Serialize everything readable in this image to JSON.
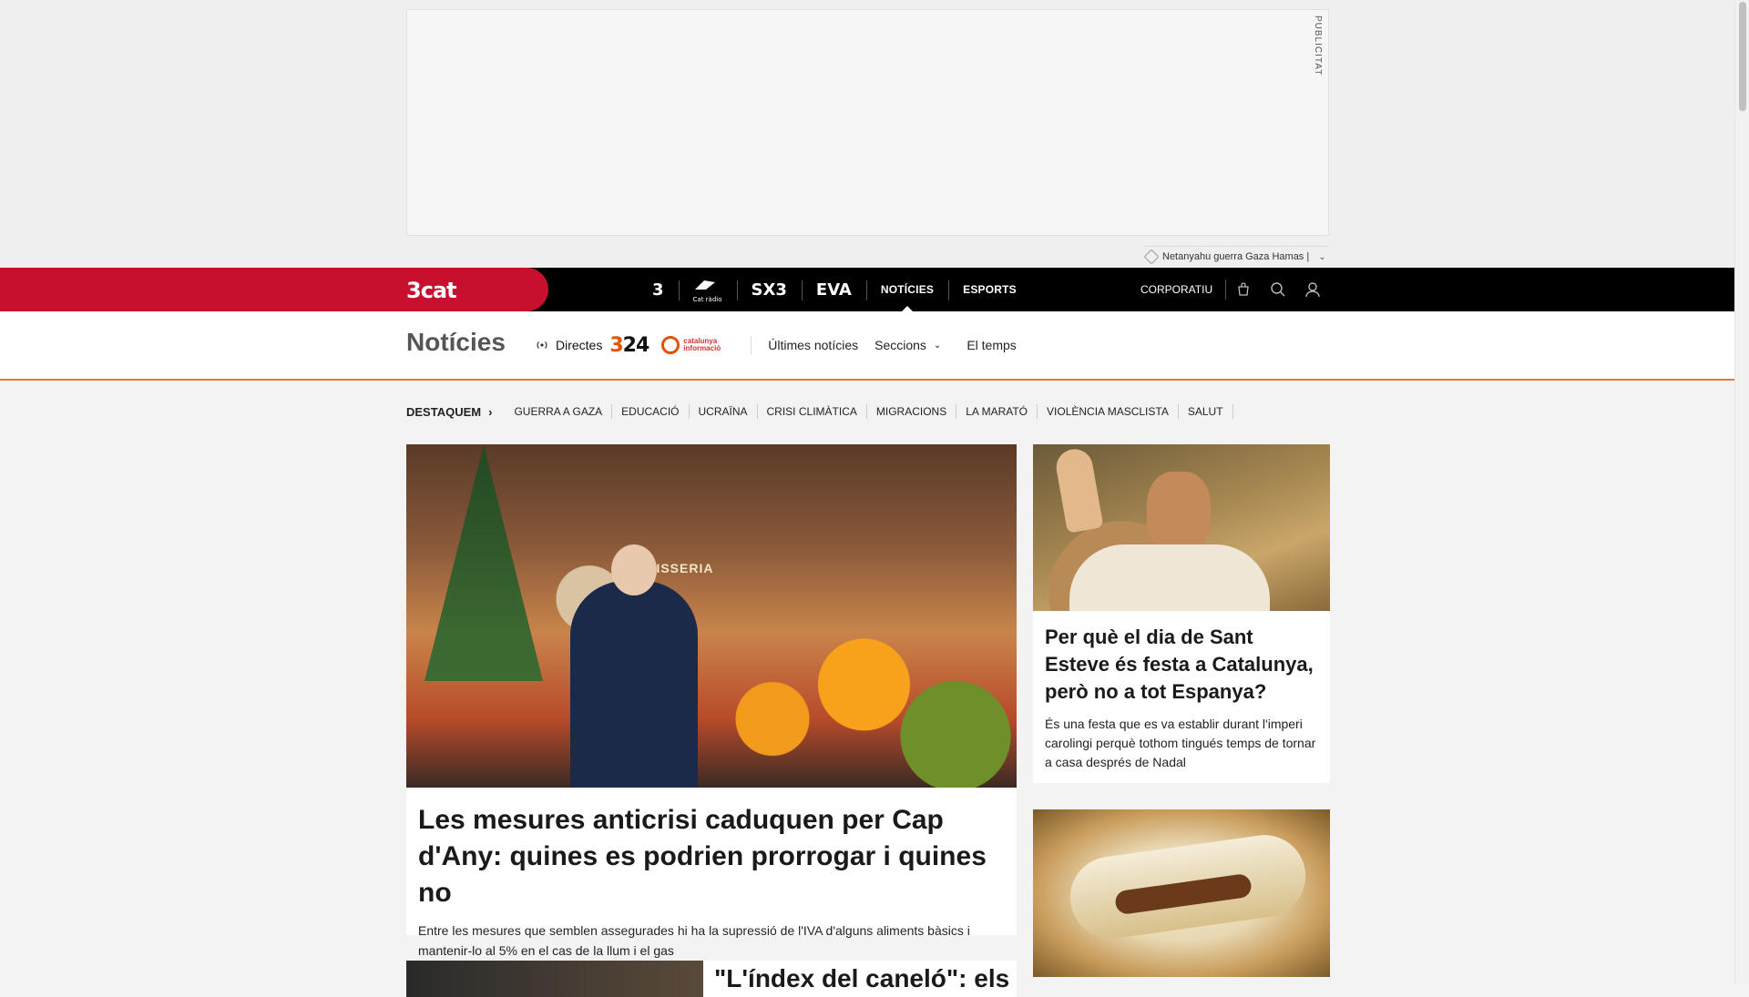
{
  "ad": {
    "label": "PUBLICITAT"
  },
  "trending": {
    "text": "Netanyahu guerra Gaza Hamas |"
  },
  "brand": {
    "logo": "3cat"
  },
  "channels": [
    {
      "label": "3",
      "icon": "tv3-logo-icon"
    },
    {
      "label": "Cat ràdio",
      "icon": "catradio-logo-icon"
    },
    {
      "label": "SX3",
      "icon": "sx3-logo-icon"
    },
    {
      "label": "EVA",
      "icon": "eva-logo-icon"
    },
    {
      "label": "NOTÍCIES"
    },
    {
      "label": "ESPORTS"
    }
  ],
  "tools": {
    "corporate": "CORPORATIU"
  },
  "section": {
    "title": "Notícies",
    "live": "Directes",
    "channel324": "324",
    "catinfo": "catalunya informació",
    "latest": "Últimes notícies",
    "sections": "Seccions",
    "weather": "El temps"
  },
  "highlights": {
    "label": "DESTAQUEM",
    "items": [
      "GUERRA A GAZA",
      "EDUCACIÓ",
      "UCRAÏNA",
      "CRISI CLIMÀTICA",
      "MIGRACIONS",
      "LA MARATÓ",
      "VIOLÈNCIA MASCLISTA",
      "SALUT"
    ]
  },
  "main_article": {
    "image_sign": "CARNISSERIA",
    "title": "Les mesures anticrisi caduquen per Cap d'Any: quines es podrien prorrogar i quines no",
    "summary": "Entre les mesures que semblen assegurades hi ha la supressió de l'IVA d'alguns aliments bàsics i mantenir-lo al 5% en el cas de la llum i el gas"
  },
  "side_article": {
    "title": "Per què el dia de Sant Esteve és festa a Catalunya, però no a tot Espanya?",
    "summary": "És una festa que es va establir durant l'imperi carolingi perquè tothom tingués temps de tornar a casa després de Nadal"
  },
  "bottom_article": {
    "title": "\"L'índex del caneló\": els"
  },
  "colors": {
    "brand_red": "#c8102e",
    "accent_orange": "#e35205"
  }
}
